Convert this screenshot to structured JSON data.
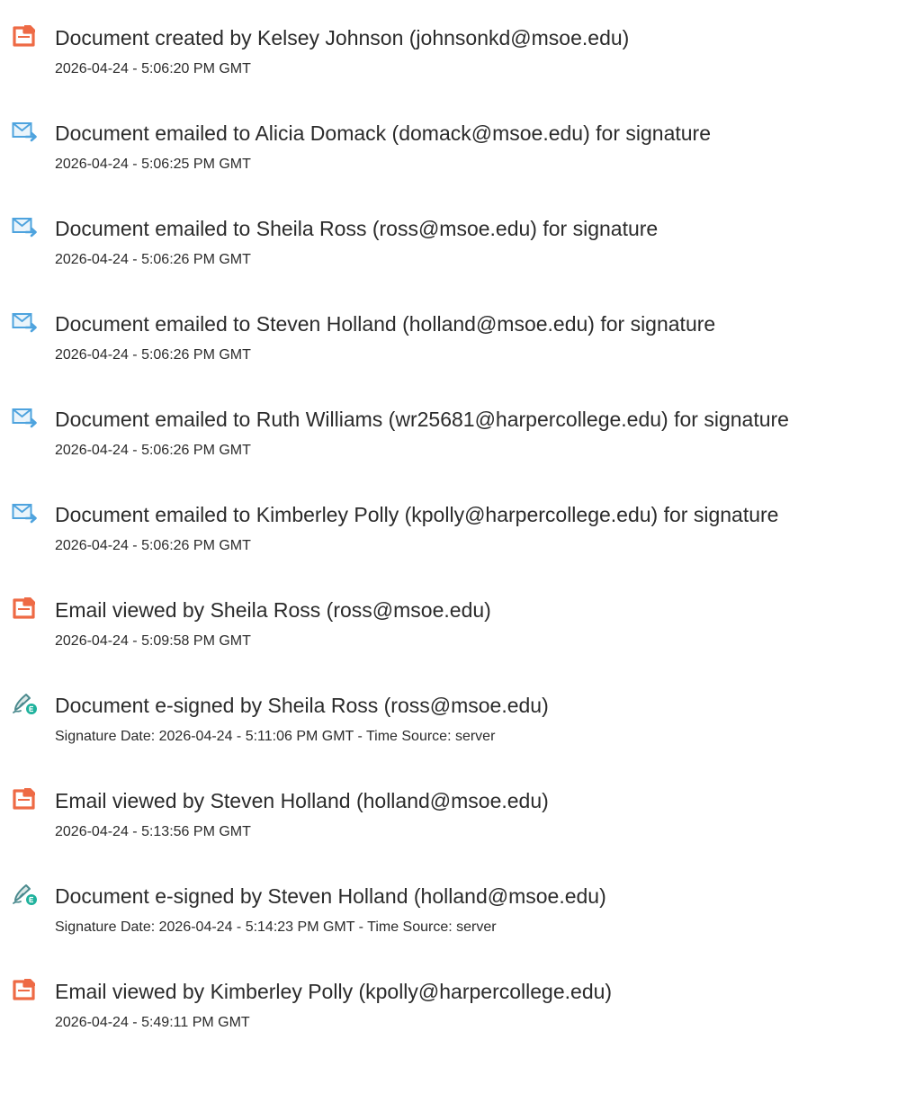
{
  "colors": {
    "created_icon": "#ee6a45",
    "emailed_icon": "#4ea3de",
    "signed_icon_pen": "#4b8a8e",
    "signed_icon_badge": "#1fb29d",
    "text": "#2b2b2b"
  },
  "events": [
    {
      "icon": "document-created-icon",
      "title": "Document created by Kelsey Johnson (johnsonkd@msoe.edu)",
      "time": "2026-04-24 - 5:06:20 PM GMT"
    },
    {
      "icon": "email-sent-icon",
      "title": "Document emailed to Alicia Domack (domack@msoe.edu) for signature",
      "time": "2026-04-24 - 5:06:25 PM GMT"
    },
    {
      "icon": "email-sent-icon",
      "title": "Document emailed to Sheila Ross (ross@msoe.edu) for signature",
      "time": "2026-04-24 - 5:06:26 PM GMT"
    },
    {
      "icon": "email-sent-icon",
      "title": "Document emailed to Steven Holland (holland@msoe.edu) for signature",
      "time": "2026-04-24 - 5:06:26 PM GMT"
    },
    {
      "icon": "email-sent-icon",
      "title": "Document emailed to Ruth Williams (wr25681@harpercollege.edu) for signature",
      "time": "2026-04-24 - 5:06:26 PM GMT"
    },
    {
      "icon": "email-sent-icon",
      "title": "Document emailed to Kimberley Polly (kpolly@harpercollege.edu) for signature",
      "time": "2026-04-24 - 5:06:26 PM GMT"
    },
    {
      "icon": "document-viewed-icon",
      "title": "Email viewed by Sheila Ross (ross@msoe.edu)",
      "time": "2026-04-24 - 5:09:58 PM GMT"
    },
    {
      "icon": "e-signed-icon",
      "title": "Document e-signed by Sheila Ross (ross@msoe.edu)",
      "time": "Signature Date: 2026-04-24 - 5:11:06 PM GMT - Time Source: server"
    },
    {
      "icon": "document-viewed-icon",
      "title": "Email viewed by Steven Holland (holland@msoe.edu)",
      "time": "2026-04-24 - 5:13:56 PM GMT"
    },
    {
      "icon": "e-signed-icon",
      "title": "Document e-signed by Steven Holland (holland@msoe.edu)",
      "time": "Signature Date: 2026-04-24 - 5:14:23 PM GMT - Time Source: server"
    },
    {
      "icon": "document-viewed-icon",
      "title": "Email viewed by Kimberley Polly (kpolly@harpercollege.edu)",
      "time": "2026-04-24 - 5:49:11 PM GMT"
    }
  ]
}
